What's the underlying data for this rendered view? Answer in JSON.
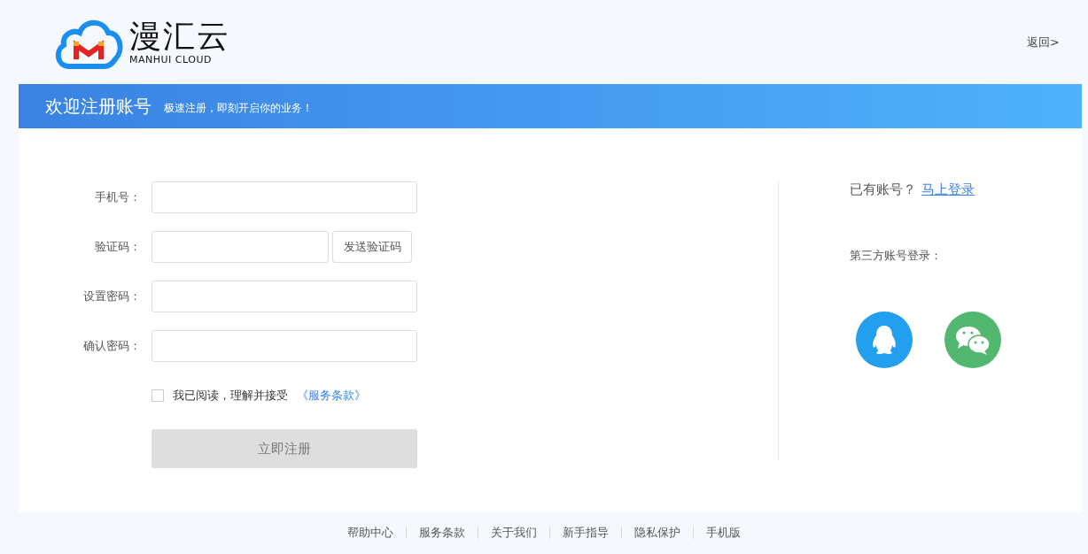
{
  "header": {
    "logo": {
      "title": "漫汇云",
      "subtitle": "MANHUI CLOUD"
    },
    "back_link": "返回>"
  },
  "banner": {
    "title": "欢迎注册账号",
    "subtitle": "极速注册，即刻开启你的业务！"
  },
  "form": {
    "fields": [
      {
        "kind": "input",
        "label": "手机号："
      },
      {
        "kind": "input-with-button",
        "label": "验证码：",
        "button": "发送验证码"
      },
      {
        "kind": "input",
        "label": "设置密码："
      },
      {
        "kind": "input",
        "label": "确认密码："
      }
    ],
    "agreement": {
      "checked": false,
      "text": "我已阅读，理解并接受",
      "link": "《服务条款》"
    },
    "submit": {
      "label": "立即注册",
      "disabled": true
    }
  },
  "side": {
    "prompt": "已有账号？",
    "login_link": "马上登录",
    "third_party_label": "第三方账号登录：",
    "providers": [
      {
        "kind": "qq"
      },
      {
        "kind": "wechat"
      }
    ]
  },
  "footer": {
    "links": [
      "帮助中心",
      "服务条款",
      "关于我们",
      "新手指导",
      "隐私保护",
      "手机版"
    ]
  }
}
